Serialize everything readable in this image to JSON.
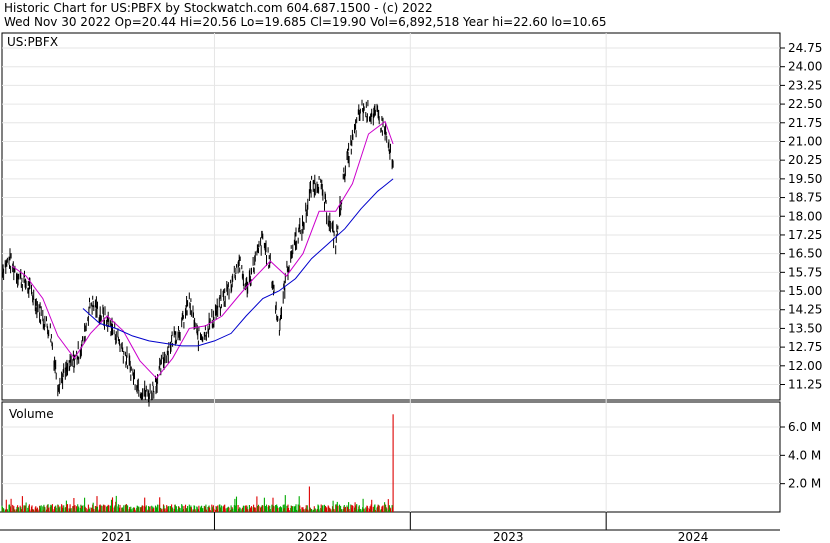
{
  "header": {
    "line1": "Historic Chart for US:PBFX by Stockwatch.com 604.687.1500 - (c) 2022",
    "line2": "Wed Nov 30 2022   Op=20.44   Hi=20.56   Lo=19.685   Cl=19.90   Vol=6,892,518   Year hi=22.60   lo=10.65"
  },
  "chart_data": [
    {
      "type": "line",
      "panel": "price",
      "symbol_label": "US:PBFX",
      "ylim": [
        10.65,
        25.0
      ],
      "y_ticks": [
        "24.75",
        "24.00",
        "23.25",
        "22.50",
        "21.75",
        "21.00",
        "20.25",
        "19.50",
        "18.75",
        "18.00",
        "17.25",
        "16.50",
        "15.75",
        "15.00",
        "14.25",
        "13.50",
        "12.75",
        "12.00",
        "11.25"
      ],
      "x_tick_labels": [
        "2021",
        "2022",
        "2023",
        "2024"
      ],
      "grid": true,
      "series": [
        {
          "style": "high-low bars",
          "color": "#000000",
          "points": [
            [
              "2020-12-01",
              15.9
            ],
            [
              "2020-12-15",
              16.2
            ],
            [
              "2021-01-01",
              15.6
            ],
            [
              "2021-01-15",
              15.3
            ],
            [
              "2021-02-01",
              14.6
            ],
            [
              "2021-02-15",
              13.9
            ],
            [
              "2021-03-01",
              13.4
            ],
            [
              "2021-03-15",
              11.3
            ],
            [
              "2021-04-01",
              11.8
            ],
            [
              "2021-04-15",
              12.2
            ],
            [
              "2021-05-01",
              12.9
            ],
            [
              "2021-05-15",
              14.6
            ],
            [
              "2021-06-01",
              14.1
            ],
            [
              "2021-06-15",
              13.8
            ],
            [
              "2021-07-01",
              13.3
            ],
            [
              "2021-07-15",
              12.6
            ],
            [
              "2021-08-01",
              11.7
            ],
            [
              "2021-08-15",
              11.1
            ],
            [
              "2021-09-01",
              10.8
            ],
            [
              "2021-09-15",
              11.4
            ],
            [
              "2021-10-01",
              12.4
            ],
            [
              "2021-10-15",
              13.1
            ],
            [
              "2021-11-01",
              13.6
            ],
            [
              "2021-11-15",
              14.6
            ],
            [
              "2021-12-01",
              13.1
            ],
            [
              "2021-12-15",
              13.4
            ],
            [
              "2022-01-01",
              14.0
            ],
            [
              "2022-01-15",
              14.6
            ],
            [
              "2022-02-01",
              15.3
            ],
            [
              "2022-02-15",
              16.2
            ],
            [
              "2022-03-01",
              15.1
            ],
            [
              "2022-03-15",
              16.0
            ],
            [
              "2022-04-01",
              17.1
            ],
            [
              "2022-04-15",
              16.0
            ],
            [
              "2022-05-01",
              13.5
            ],
            [
              "2022-05-15",
              15.7
            ],
            [
              "2022-06-01",
              17.1
            ],
            [
              "2022-06-15",
              17.6
            ],
            [
              "2022-07-01",
              19.2
            ],
            [
              "2022-07-15",
              19.4
            ],
            [
              "2022-08-01",
              18.0
            ],
            [
              "2022-08-15",
              16.9
            ],
            [
              "2022-09-01",
              19.9
            ],
            [
              "2022-09-15",
              21.0
            ],
            [
              "2022-10-01",
              22.3
            ],
            [
              "2022-10-15",
              22.2
            ],
            [
              "2022-11-01",
              22.0
            ],
            [
              "2022-11-15",
              21.4
            ],
            [
              "2022-11-30",
              19.9
            ]
          ]
        },
        {
          "style": "moving average (short)",
          "color": "#cc00cc",
          "points": [
            [
              "2020-12-20",
              16.0
            ],
            [
              "2021-01-15",
              15.6
            ],
            [
              "2021-02-15",
              14.7
            ],
            [
              "2021-03-15",
              13.2
            ],
            [
              "2021-04-15",
              12.3
            ],
            [
              "2021-05-15",
              13.3
            ],
            [
              "2021-06-15",
              14.0
            ],
            [
              "2021-07-15",
              13.4
            ],
            [
              "2021-08-15",
              12.2
            ],
            [
              "2021-09-15",
              11.5
            ],
            [
              "2021-10-15",
              12.3
            ],
            [
              "2021-11-15",
              13.5
            ],
            [
              "2021-12-15",
              13.6
            ],
            [
              "2022-01-15",
              14.0
            ],
            [
              "2022-02-15",
              14.8
            ],
            [
              "2022-03-15",
              15.5
            ],
            [
              "2022-04-15",
              16.2
            ],
            [
              "2022-05-15",
              15.6
            ],
            [
              "2022-06-15",
              16.5
            ],
            [
              "2022-07-15",
              18.2
            ],
            [
              "2022-08-15",
              18.2
            ],
            [
              "2022-09-15",
              19.3
            ],
            [
              "2022-10-15",
              21.3
            ],
            [
              "2022-11-15",
              21.8
            ],
            [
              "2022-11-30",
              20.9
            ]
          ]
        },
        {
          "style": "moving average (long)",
          "color": "#0000cc",
          "points": [
            [
              "2021-05-01",
              14.3
            ],
            [
              "2021-06-01",
              13.7
            ],
            [
              "2021-07-01",
              13.5
            ],
            [
              "2021-08-01",
              13.2
            ],
            [
              "2021-09-01",
              13.0
            ],
            [
              "2021-10-01",
              12.9
            ],
            [
              "2021-11-01",
              12.8
            ],
            [
              "2021-12-01",
              12.8
            ],
            [
              "2022-01-01",
              13.0
            ],
            [
              "2022-02-01",
              13.3
            ],
            [
              "2022-03-01",
              14.0
            ],
            [
              "2022-04-01",
              14.7
            ],
            [
              "2022-05-01",
              15.0
            ],
            [
              "2022-06-01",
              15.5
            ],
            [
              "2022-07-01",
              16.3
            ],
            [
              "2022-08-01",
              16.9
            ],
            [
              "2022-09-01",
              17.5
            ],
            [
              "2022-10-01",
              18.3
            ],
            [
              "2022-11-01",
              19.0
            ],
            [
              "2022-11-30",
              19.5
            ]
          ]
        }
      ]
    },
    {
      "type": "bar",
      "panel": "volume",
      "title": "Volume",
      "ylim": [
        0,
        7.5
      ],
      "y_ticks": [
        "2.0 M",
        "4.0 M",
        "6.0 M"
      ],
      "colors": {
        "up": "#00aa00",
        "down": "#dd0000"
      },
      "typical_volume_m": 0.35,
      "notable_bars": [
        [
          "2022-03-21",
          1.1,
          "down"
        ],
        [
          "2022-06-27",
          1.8,
          "down"
        ],
        [
          "2022-08-10",
          0.8,
          "up"
        ],
        [
          "2022-09-08",
          0.7,
          "up"
        ],
        [
          "2022-11-30",
          6.9,
          "down"
        ]
      ]
    }
  ]
}
